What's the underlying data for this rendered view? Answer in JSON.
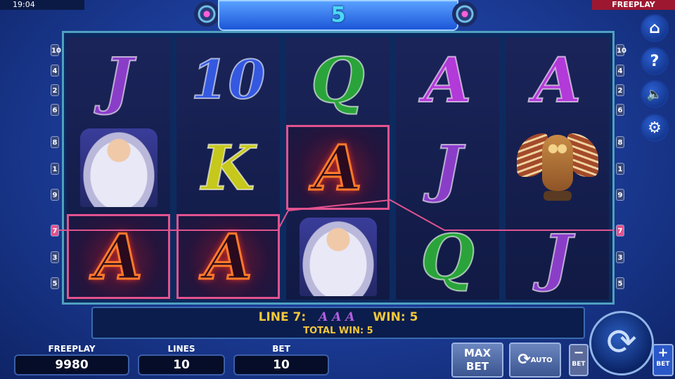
{
  "status": {
    "clock": "19:04",
    "mode": "FREEPLAY"
  },
  "free_games_count": "5",
  "reels": [
    {
      "symbols": [
        "J",
        "wizard",
        "A"
      ]
    },
    {
      "symbols": [
        "10",
        "K",
        "A"
      ]
    },
    {
      "symbols": [
        "Q",
        "A",
        "wizard"
      ]
    },
    {
      "symbols": [
        "A",
        "J",
        "Q"
      ]
    },
    {
      "symbols": [
        "A",
        "owl",
        "J"
      ]
    }
  ],
  "line_markers_left": [
    "10",
    "4",
    "2",
    "6",
    "8",
    "1",
    "9",
    "7",
    "3",
    "5"
  ],
  "line_markers_right": [
    "10",
    "4",
    "2",
    "6",
    "8",
    "1",
    "9",
    "7",
    "3",
    "5"
  ],
  "colors": {
    "winning_line": "#e2538f",
    "marker_active": "#e2538f"
  },
  "info": {
    "line_label": "LINE 7:",
    "line_symbols": "A A A",
    "win_label": "WIN: 5",
    "total_win": "TOTAL WIN: 5"
  },
  "panels": {
    "freeplay_label": "FREEPLAY",
    "freeplay_value": "9980",
    "lines_label": "LINES",
    "lines_value": "10",
    "bet_label": "BET",
    "bet_value": "10"
  },
  "buttons": {
    "max_bet_line1": "MAX",
    "max_bet_line2": "BET",
    "auto": "AUTO",
    "bet_minus": "BET",
    "bet_plus": "BET"
  },
  "side_icons": [
    "home-icon",
    "help-icon",
    "sound-off-icon",
    "settings-icon"
  ]
}
